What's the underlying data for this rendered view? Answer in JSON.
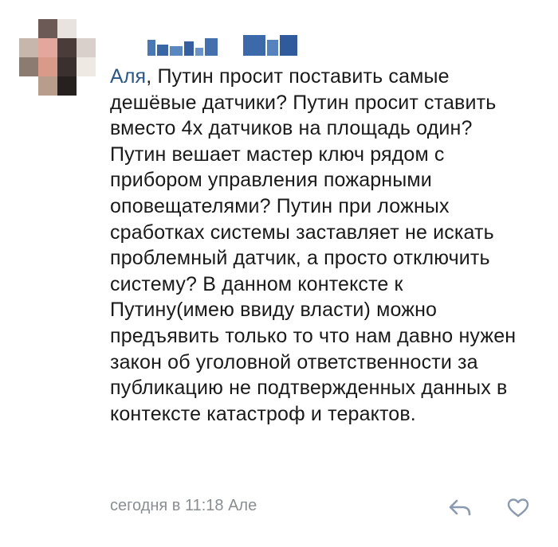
{
  "comment": {
    "reply_to": "Аля",
    "text": ", Путин просит поставить самые дешёвые датчики? Путин просит ставить вместо 4х датчиков на площадь один? Путин вешает мастер ключ рядом с прибором управления пожарными оповещателями? Путин при ложных сработках системы заставляет не искать проблемный датчик, а просто отключить систему? В данном контексте к Путину(имею ввиду власти) можно предъявить только то что нам давно нужен закон об уголовной ответственности за публикацию не подтвержденных данных в контексте катастроф и терактов.",
    "timestamp": "сегодня в 11:18",
    "reply_target": "Але"
  },
  "icons": {
    "reply": "reply-arrow-icon",
    "like": "heart-icon"
  },
  "colors": {
    "link": "#2a5885",
    "text": "#1a1a1a",
    "meta": "#8a8e92",
    "icon": "#8a9bb0"
  }
}
